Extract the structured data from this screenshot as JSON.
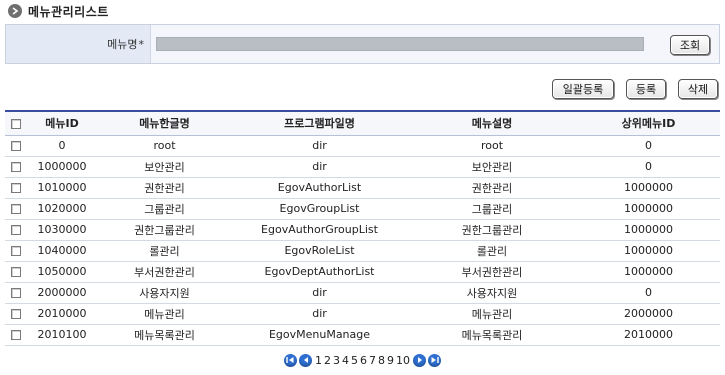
{
  "header": {
    "title": "메뉴관리리스트"
  },
  "search": {
    "label": "메뉴명",
    "required_mark": "*",
    "value": "",
    "button_label": "조회"
  },
  "actions": {
    "bulk_register_label": "일괄등록",
    "register_label": "등록",
    "delete_label": "삭제"
  },
  "table": {
    "columns": [
      "메뉴ID",
      "메뉴한글명",
      "프로그램파일명",
      "메뉴설명",
      "상위메뉴ID"
    ],
    "rows": [
      [
        "0",
        "root",
        "dir",
        "root",
        "0"
      ],
      [
        "1000000",
        "보안관리",
        "dir",
        "보안관리",
        "0"
      ],
      [
        "1010000",
        "권한관리",
        "EgovAuthorList",
        "권한관리",
        "1000000"
      ],
      [
        "1020000",
        "그룹관리",
        "EgovGroupList",
        "그룹관리",
        "1000000"
      ],
      [
        "1030000",
        "권한그룹관리",
        "EgovAuthorGroupList",
        "권한그룹관리",
        "1000000"
      ],
      [
        "1040000",
        "롤관리",
        "EgovRoleList",
        "롤관리",
        "1000000"
      ],
      [
        "1050000",
        "부서권한관리",
        "EgovDeptAuthorList",
        "부서권한관리",
        "1000000"
      ],
      [
        "2000000",
        "사용자지원",
        "dir",
        "사용자지원",
        "0"
      ],
      [
        "2010000",
        "메뉴관리",
        "dir",
        "메뉴관리",
        "2000000"
      ],
      [
        "2010100",
        "메뉴목록관리",
        "EgovMenuManage",
        "메뉴목록관리",
        "2010000"
      ]
    ]
  },
  "pagination": {
    "pages": [
      "1",
      "2",
      "3",
      "4",
      "5",
      "6",
      "7",
      "8",
      "9",
      "10"
    ],
    "current": "1",
    "icons": [
      "first-page-icon",
      "prev-page-icon",
      "next-page-icon",
      "last-page-icon"
    ]
  },
  "colors": {
    "header_rule": "#3a4ea0",
    "label_cell": "#e3e9f5",
    "pager_button": "#2f6fd1"
  }
}
